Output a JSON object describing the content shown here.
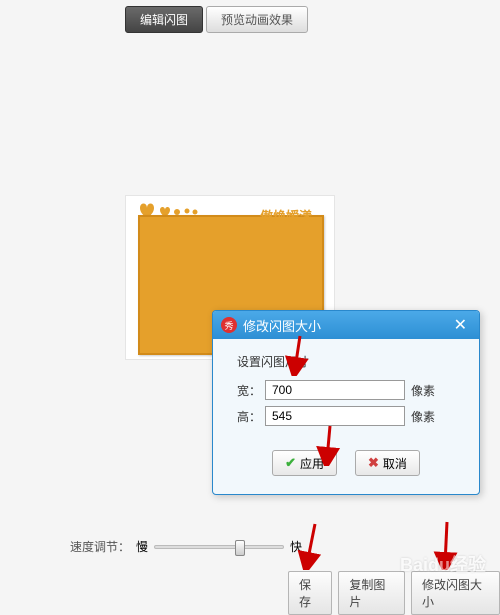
{
  "tabs": {
    "edit": "编辑闪图",
    "preview": "预览动画效果"
  },
  "preview": {
    "text": "傲焕嫒漾"
  },
  "dialog": {
    "title": "修改闪图大小",
    "subtitle": "设置闪图尺寸",
    "width_label": "宽：",
    "height_label": "高：",
    "width_value": "700",
    "height_value": "545",
    "unit": "像素",
    "apply": "应用",
    "cancel": "取消"
  },
  "slider": {
    "label": "速度调节：",
    "slow": "慢",
    "fast": "快"
  },
  "buttons": {
    "save": "保存",
    "copy": "复制图片",
    "resize": "修改闪图大小"
  },
  "watermark": "Baidu经验"
}
